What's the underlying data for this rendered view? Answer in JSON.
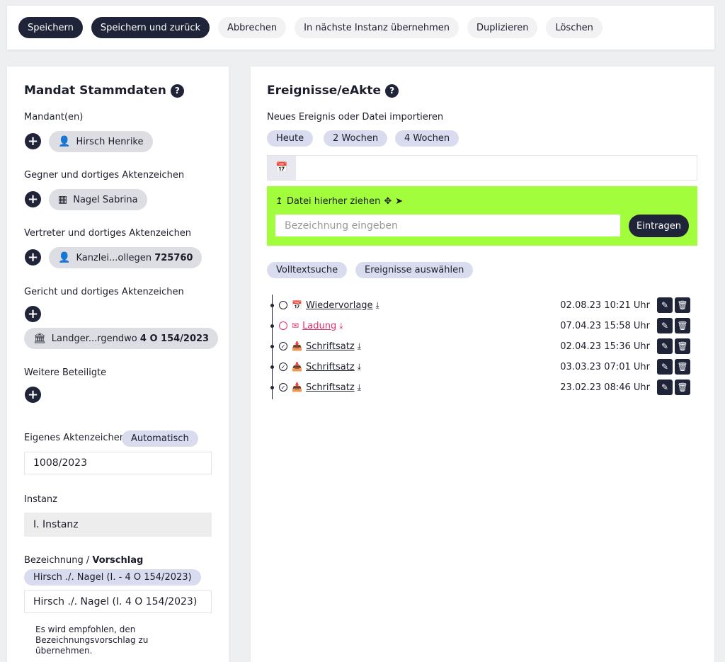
{
  "toolbar": {
    "save": "Speichern",
    "save_back": "Speichern und zurück",
    "cancel": "Abbrechen",
    "next_instance": "In nächste Instanz übernehmen",
    "duplicate": "Duplizieren",
    "delete": "Löschen"
  },
  "left": {
    "title": "Mandat Stammdaten",
    "help": "?",
    "mandanten_label": "Mandant(en)",
    "mandant_chip": "Hirsch Henrike",
    "gegner_label": "Gegner und dortiges Aktenzeichen",
    "gegner_chip": "Nagel Sabrina",
    "vertreter_label": "Vertreter und dortiges Aktenzeichen",
    "vertreter_chip_name": "Kanzlei...ollegen",
    "vertreter_chip_az": "725760",
    "gericht_label": "Gericht und dortiges Aktenzeichen",
    "gericht_chip_name": "Landger...rgendwo",
    "gericht_chip_az": "4 O 154/2023",
    "weitere_label": "Weitere Beteiligte",
    "eigenes_label": "Eigenes Aktenzeichen",
    "eigenes_pill": "Automatisch",
    "eigenes_value": "1008/2023",
    "instanz_label": "Instanz",
    "instanz_value": "I. Instanz",
    "bezeichnung_label": "Bezeichnung / ",
    "bezeichnung_label_bold": "Vorschlag",
    "bezeichnung_pill": "Hirsch ./. Nagel (I. - 4 O 154/2023)",
    "bezeichnung_value": "Hirsch ./. Nagel (I. 4 O 154/2023)",
    "hint": "Es wird empfohlen, den Bezeichnungsvorschlag zu übernehmen."
  },
  "right": {
    "title": "Ereignisse/eAkte",
    "help": "?",
    "import_label": "Neues Ereignis oder Datei importieren",
    "quick_today": "Heute",
    "quick_2w": "2 Wochen",
    "quick_4w": "4 Wochen",
    "dropzone_label": "Datei hierher ziehen",
    "dropzone_placeholder": "Bezeichnung eingeben",
    "dropzone_button": "Eintragen",
    "volltext": "Volltextsuche",
    "auswaehlen": "Ereignisse auswählen",
    "events": [
      {
        "name": "Wiedervorlage",
        "date": "02.08.23 10:21 Uhr",
        "icon": "calendar-icon",
        "done": false,
        "red": false
      },
      {
        "name": "Ladung",
        "date": "07.04.23 15:58 Uhr",
        "icon": "envelope-icon",
        "done": false,
        "red": true
      },
      {
        "name": "Schriftsatz",
        "date": "02.04.23 15:36 Uhr",
        "icon": "inbox-icon",
        "done": true,
        "red": false
      },
      {
        "name": "Schriftsatz",
        "date": "03.03.23 07:01 Uhr",
        "icon": "inbox-icon",
        "done": true,
        "red": false
      },
      {
        "name": "Schriftsatz",
        "date": "23.02.23 08:46 Uhr",
        "icon": "inbox-icon",
        "done": true,
        "red": false
      }
    ]
  }
}
